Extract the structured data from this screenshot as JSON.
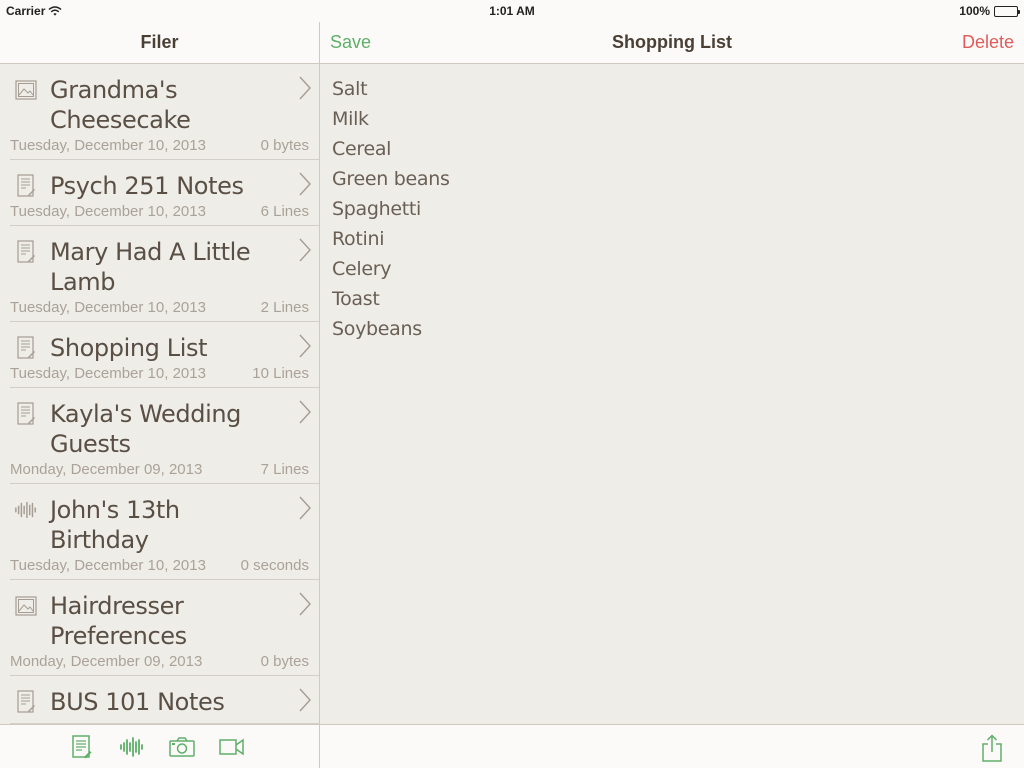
{
  "status_bar": {
    "carrier": "Carrier",
    "time": "1:01 AM",
    "battery": "100%"
  },
  "left": {
    "title": "Filer",
    "files": [
      {
        "title": "Grandma's Cheesecake",
        "date": "Tuesday, December 10, 2013",
        "size": "0 bytes",
        "icon": "image-icon"
      },
      {
        "title": "Psych 251 Notes",
        "date": "Tuesday, December 10, 2013",
        "size": "6 Lines",
        "icon": "document-icon"
      },
      {
        "title": "Mary Had A Little Lamb",
        "date": "Tuesday, December 10, 2013",
        "size": "2 Lines",
        "icon": "document-icon"
      },
      {
        "title": "Shopping List",
        "date": "Tuesday, December 10, 2013",
        "size": "10 Lines",
        "icon": "document-icon"
      },
      {
        "title": "Kayla's Wedding Guests",
        "date": "Monday, December 09, 2013",
        "size": "7 Lines",
        "icon": "document-icon"
      },
      {
        "title": "John's 13th Birthday",
        "date": "Tuesday, December 10, 2013",
        "size": "0 seconds",
        "icon": "audio-waveform-icon"
      },
      {
        "title": "Hairdresser Preferences",
        "date": "Monday, December 09, 2013",
        "size": "0 bytes",
        "icon": "image-icon"
      },
      {
        "title": "BUS 101 Notes",
        "date": "",
        "size": "",
        "icon": "document-icon"
      }
    ],
    "toolbar_icons": [
      "new-document-icon",
      "audio-waveform-icon",
      "camera-icon",
      "video-camera-icon"
    ]
  },
  "right": {
    "save_label": "Save",
    "title": "Shopping List",
    "delete_label": "Delete",
    "content": [
      "Salt",
      "Milk",
      "Cereal",
      "Green beans",
      "Spaghetti",
      "Rotini",
      "Celery",
      "Toast",
      "Soybeans"
    ]
  },
  "colors": {
    "accent_green": "#5fae6a",
    "delete_red": "#e05c5c",
    "text_brown": "#5a4f45",
    "background": "#efede8"
  }
}
